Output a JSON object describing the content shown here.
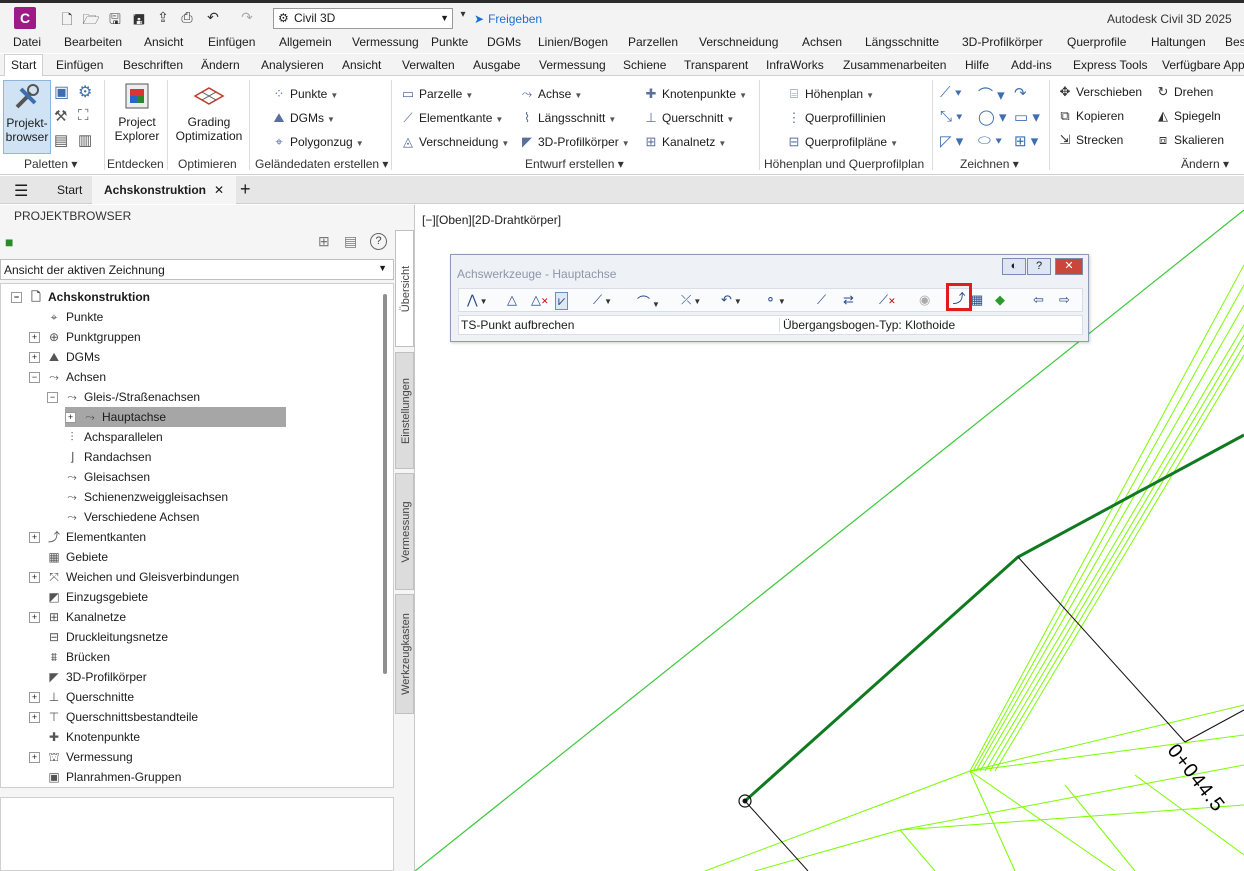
{
  "app": {
    "logo": "C",
    "workspace": "Civil 3D",
    "share_label": "Freigeben",
    "title": "Autodesk Civil 3D 2025"
  },
  "menu": [
    "Datei",
    "Bearbeiten",
    "Ansicht",
    "Einfügen",
    "Allgemein",
    "Vermessung",
    "Punkte",
    "DGMs",
    "Linien/Bogen",
    "Parzellen",
    "Verschneidung",
    "Achsen",
    "Längsschnitte",
    "3D-Profilkörper",
    "Querprofile",
    "Haltungen",
    "Bes"
  ],
  "tabs": [
    "Start",
    "Einfügen",
    "Beschriften",
    "Ändern",
    "Analysieren",
    "Ansicht",
    "Verwalten",
    "Ausgabe",
    "Vermessung",
    "Schiene",
    "Transparent",
    "InfraWorks",
    "Zusammenarbeiten",
    "Hilfe",
    "Add-ins",
    "Express Tools",
    "Verfügbare App"
  ],
  "ribbon": {
    "panels": {
      "paletten": "Paletten",
      "entdecken": "Entdecken",
      "optimieren": "Optimieren",
      "gelaende": "Geländedaten erstellen",
      "entwurf": "Entwurf erstellen",
      "hoehenplan": "Höhenplan und Querprofilplan",
      "zeichnen": "Zeichnen",
      "aendern": "Ändern"
    },
    "big": {
      "projektbrowser_1": "Projekt-",
      "projektbrowser_2": "browser",
      "project_explorer_1": "Project",
      "project_explorer_2": "Explorer",
      "grading_1": "Grading",
      "grading_2": "Optimization"
    },
    "gelaende": [
      "Punkte",
      "DGMs",
      "Polygonzug"
    ],
    "entwurf_col1": [
      "Parzelle",
      "Elementkante",
      "Verschneidung"
    ],
    "entwurf_col2": [
      "Achse",
      "Längsschnitt",
      "3D-Profilkörper"
    ],
    "entwurf_col3": [
      "Knotenpunkte",
      "Querschnitt",
      "Kanalnetz"
    ],
    "hoehenplan": [
      "Höhenplan",
      "Querprofillinien",
      "Querprofilpläne"
    ],
    "aendern_col1": [
      "Verschieben",
      "Kopieren",
      "Strecken"
    ],
    "aendern_col2": [
      "Drehen",
      "Spiegeln",
      "Skalieren"
    ]
  },
  "doc_tabs": {
    "start": "Start",
    "active": "Achskonstruktion"
  },
  "prospector": {
    "header": "PROJEKTBROWSER",
    "view_select": "Ansicht der aktiven Zeichnung",
    "tree": [
      {
        "label": "Achskonstruktion",
        "icon": "drawing-icon",
        "level": 0,
        "toggle": "-",
        "bold": true
      },
      {
        "label": "Punkte",
        "icon": "point-icon",
        "level": 1,
        "toggle": ""
      },
      {
        "label": "Punktgruppen",
        "icon": "point-group-icon",
        "level": 1,
        "toggle": "+"
      },
      {
        "label": "DGMs",
        "icon": "surface-icon",
        "level": 1,
        "toggle": "+"
      },
      {
        "label": "Achsen",
        "icon": "alignment-icon",
        "level": 1,
        "toggle": "-"
      },
      {
        "label": "Gleis-/Straßenachsen",
        "icon": "alignment-icon",
        "level": 2,
        "toggle": "-"
      },
      {
        "label": "Hauptachse",
        "icon": "alignment-icon",
        "level": 3,
        "toggle": "+",
        "selected": true
      },
      {
        "label": "Achsparallelen",
        "icon": "offset-alignment-icon",
        "level": 2,
        "toggle": ""
      },
      {
        "label": "Randachsen",
        "icon": "curb-alignment-icon",
        "level": 2,
        "toggle": ""
      },
      {
        "label": "Gleisachsen",
        "icon": "rail-alignment-icon",
        "level": 2,
        "toggle": ""
      },
      {
        "label": "Schienenzweiggleisachsen",
        "icon": "rail-branch-icon",
        "level": 2,
        "toggle": ""
      },
      {
        "label": "Verschiedene Achsen",
        "icon": "misc-alignment-icon",
        "level": 2,
        "toggle": ""
      },
      {
        "label": "Elementkanten",
        "icon": "feature-line-icon",
        "level": 1,
        "toggle": "+"
      },
      {
        "label": "Gebiete",
        "icon": "sites-icon",
        "level": 1,
        "toggle": ""
      },
      {
        "label": "Weichen und Gleisverbindungen",
        "icon": "turnout-icon",
        "level": 1,
        "toggle": "+"
      },
      {
        "label": "Einzugsgebiete",
        "icon": "catchment-icon",
        "level": 1,
        "toggle": ""
      },
      {
        "label": "Kanalnetze",
        "icon": "pipe-network-icon",
        "level": 1,
        "toggle": "+"
      },
      {
        "label": "Druckleitungsnetze",
        "icon": "pressure-network-icon",
        "level": 1,
        "toggle": ""
      },
      {
        "label": "Brücken",
        "icon": "bridge-icon",
        "level": 1,
        "toggle": ""
      },
      {
        "label": "3D-Profilkörper",
        "icon": "corridor-icon",
        "level": 1,
        "toggle": ""
      },
      {
        "label": "Querschnitte",
        "icon": "assembly-icon",
        "level": 1,
        "toggle": "+"
      },
      {
        "label": "Querschnittsbestandteile",
        "icon": "subassembly-icon",
        "level": 1,
        "toggle": "+"
      },
      {
        "label": "Knotenpunkte",
        "icon": "intersection-icon",
        "level": 1,
        "toggle": ""
      },
      {
        "label": "Vermessung",
        "icon": "survey-icon",
        "level": 1,
        "toggle": "+"
      },
      {
        "label": "Planrahmen-Gruppen",
        "icon": "view-frame-icon",
        "level": 1,
        "toggle": ""
      }
    ],
    "side_tabs": [
      "Übersicht",
      "Einstellungen",
      "Vermessung",
      "Werkzeugkasten"
    ]
  },
  "viewport": {
    "label": "[−][Oben][2D-Drahtkörper]",
    "station_label": "0+044.5"
  },
  "alignment_toolbar": {
    "title": "Achswerkzeuge - Hauptachse",
    "status_left": "TS-Punkt aufbrechen",
    "status_right": "Übergangsbogen-Typ: Klothoide",
    "highlight_color": "#e21c1c"
  },
  "colors": {
    "alignment": "#0f7a1f",
    "lines": "#7cfc00"
  }
}
